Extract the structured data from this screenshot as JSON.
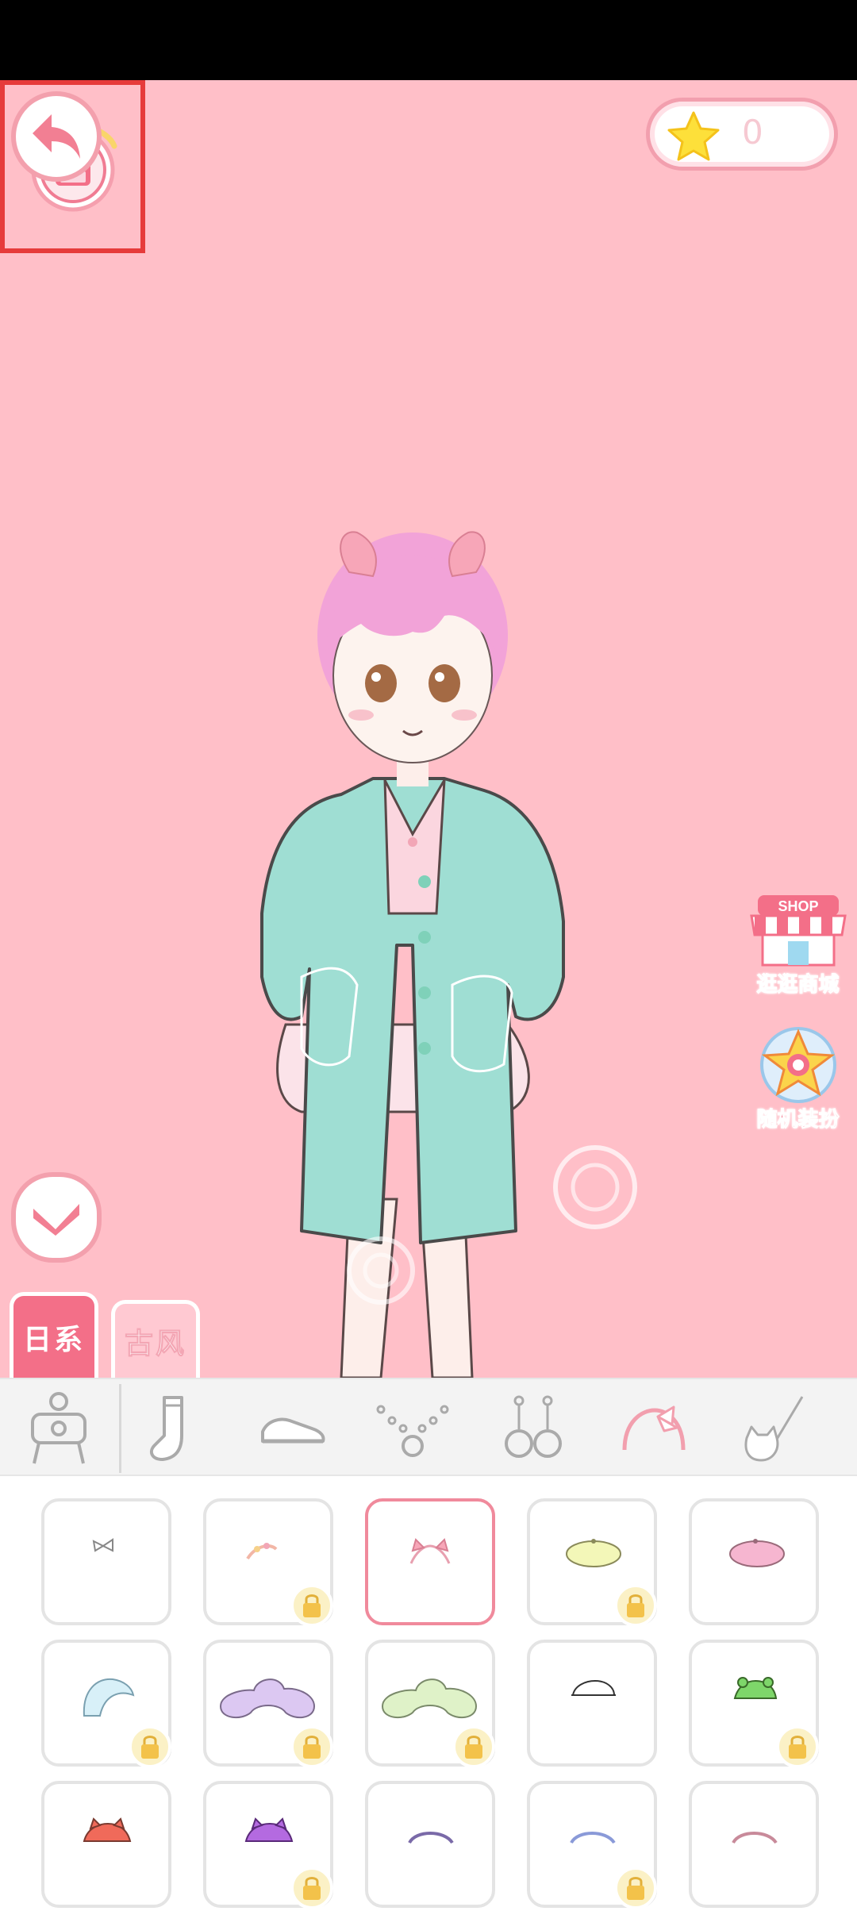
{
  "header": {
    "coin_count": "0"
  },
  "side_buttons": {
    "shop_sign": "SHOP",
    "shop_label": "逛逛商城",
    "random_label": "随机装扮"
  },
  "style_tabs": [
    {
      "label": "日系",
      "selected": true
    },
    {
      "label": "古风",
      "selected": false
    }
  ],
  "categories": [
    {
      "icon": "photo-stand-icon",
      "selected": true
    },
    {
      "icon": "sock-icon"
    },
    {
      "icon": "shoe-icon"
    },
    {
      "icon": "necklace-icon"
    },
    {
      "icon": "earring-icon"
    },
    {
      "icon": "headband-icon"
    },
    {
      "icon": "cat-wand-icon"
    }
  ],
  "items": [
    {
      "name": "bow-pin",
      "locked": false,
      "selected": false
    },
    {
      "name": "floral-pin",
      "locked": true,
      "selected": false
    },
    {
      "name": "pink-ears-headband",
      "locked": false,
      "selected": true
    },
    {
      "name": "yellow-beret",
      "locked": true,
      "selected": false
    },
    {
      "name": "pink-beret",
      "locked": false,
      "selected": false
    },
    {
      "name": "blue-earmuff",
      "locked": true,
      "selected": false
    },
    {
      "name": "purple-sunhat",
      "locked": true,
      "selected": false
    },
    {
      "name": "green-sunhat",
      "locked": true,
      "selected": false
    },
    {
      "name": "white-cap",
      "locked": false,
      "selected": false
    },
    {
      "name": "frog-cap",
      "locked": true,
      "selected": false
    },
    {
      "name": "red-cat-ears",
      "locked": false,
      "selected": false
    },
    {
      "name": "purple-cat-ears",
      "locked": true,
      "selected": false
    },
    {
      "name": "purple-thin-band",
      "locked": false,
      "selected": false
    },
    {
      "name": "blue-thin-band",
      "locked": true,
      "selected": false
    },
    {
      "name": "pink-thin-band",
      "locked": false,
      "selected": false
    }
  ],
  "colors": {
    "background": "#ffbfc8",
    "accent": "#f36f88",
    "coat": "#9fded3",
    "highlight_box": "#e63b3b"
  }
}
